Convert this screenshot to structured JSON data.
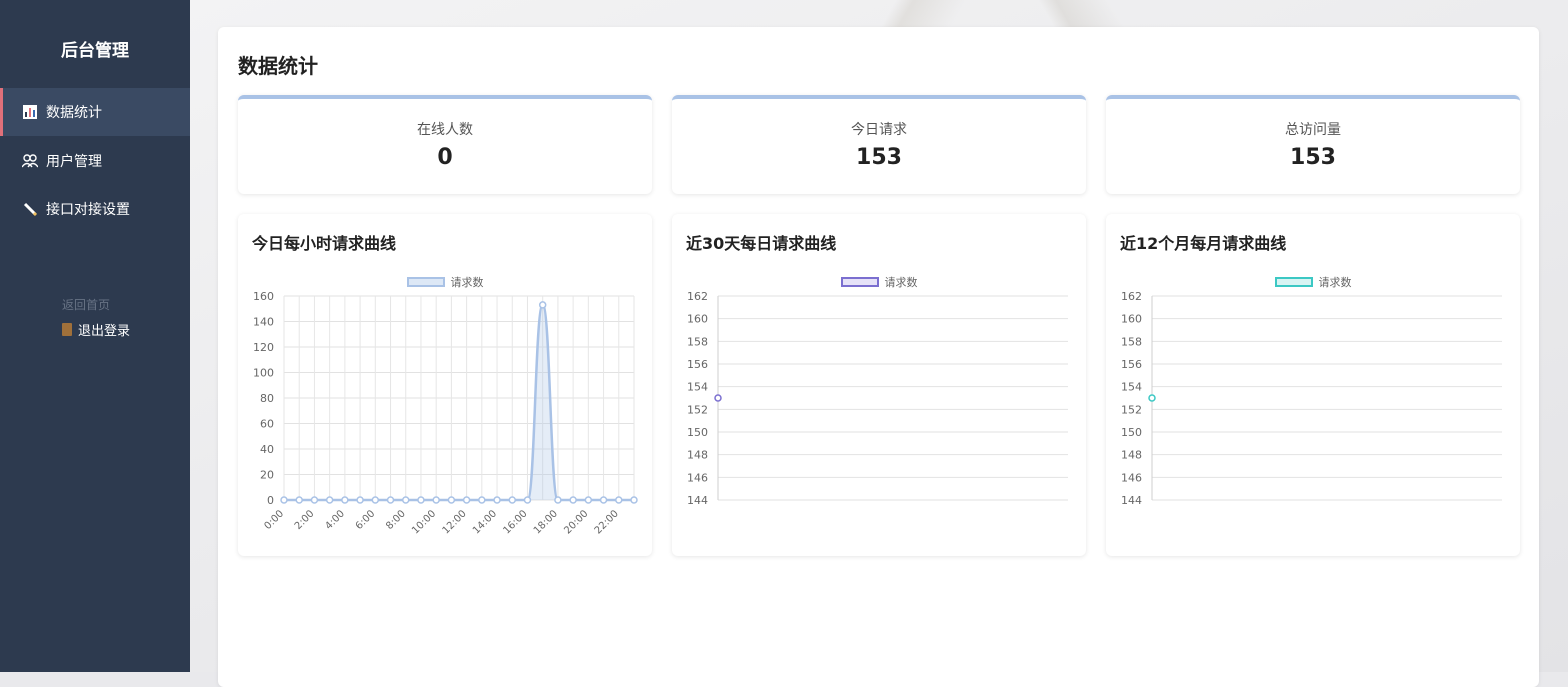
{
  "sidebar": {
    "brand": "后台管理",
    "items": [
      {
        "label": "数据统计",
        "icon": "bar-chart-icon"
      },
      {
        "label": "用户管理",
        "icon": "users-icon"
      },
      {
        "label": "接口对接设置",
        "icon": "pencil-icon"
      }
    ],
    "faded_label": "返回首页",
    "logout": "退出登录"
  },
  "main": {
    "title": "数据统计",
    "stats": [
      {
        "label": "在线人数",
        "value": "0"
      },
      {
        "label": "今日请求",
        "value": "153"
      },
      {
        "label": "总访问量",
        "value": "153"
      }
    ]
  },
  "colors": {
    "sidebar": "#2d3a4f",
    "active_accent": "#e0707a",
    "series1": "#a9c2e6",
    "series2": "#7b6fd0",
    "series3": "#3cc8c4"
  },
  "chart_data": [
    {
      "type": "area",
      "title": "今日每小时请求曲线",
      "legend": "请求数",
      "x": [
        "0:00",
        "1:00",
        "2:00",
        "3:00",
        "4:00",
        "5:00",
        "6:00",
        "7:00",
        "8:00",
        "9:00",
        "10:00",
        "11:00",
        "12:00",
        "13:00",
        "14:00",
        "15:00",
        "16:00",
        "17:00",
        "18:00",
        "19:00",
        "20:00",
        "21:00",
        "22:00",
        "23:00"
      ],
      "xticks": [
        "0:00",
        "2:00",
        "4:00",
        "6:00",
        "8:00",
        "10:00",
        "12:00",
        "14:00",
        "16:00",
        "18:00",
        "20:00",
        "22:00"
      ],
      "values": [
        0,
        0,
        0,
        0,
        0,
        0,
        0,
        0,
        0,
        0,
        0,
        0,
        0,
        0,
        0,
        0,
        0,
        153,
        0,
        0,
        0,
        0,
        0,
        0
      ],
      "ylim": [
        0,
        160
      ],
      "yticks": [
        0,
        20,
        40,
        60,
        80,
        100,
        120,
        140,
        160
      ],
      "grid": true
    },
    {
      "type": "line",
      "title": "近30天每日请求曲线",
      "legend": "请求数",
      "x": [
        ""
      ],
      "values": [
        153
      ],
      "ylim": [
        144,
        162
      ],
      "yticks": [
        144,
        146,
        148,
        150,
        152,
        154,
        156,
        158,
        160,
        162
      ],
      "grid": true
    },
    {
      "type": "line",
      "title": "近12个月每月请求曲线",
      "legend": "请求数",
      "x": [
        ""
      ],
      "values": [
        153
      ],
      "ylim": [
        144,
        162
      ],
      "yticks": [
        144,
        146,
        148,
        150,
        152,
        154,
        156,
        158,
        160,
        162
      ],
      "grid": true
    }
  ]
}
